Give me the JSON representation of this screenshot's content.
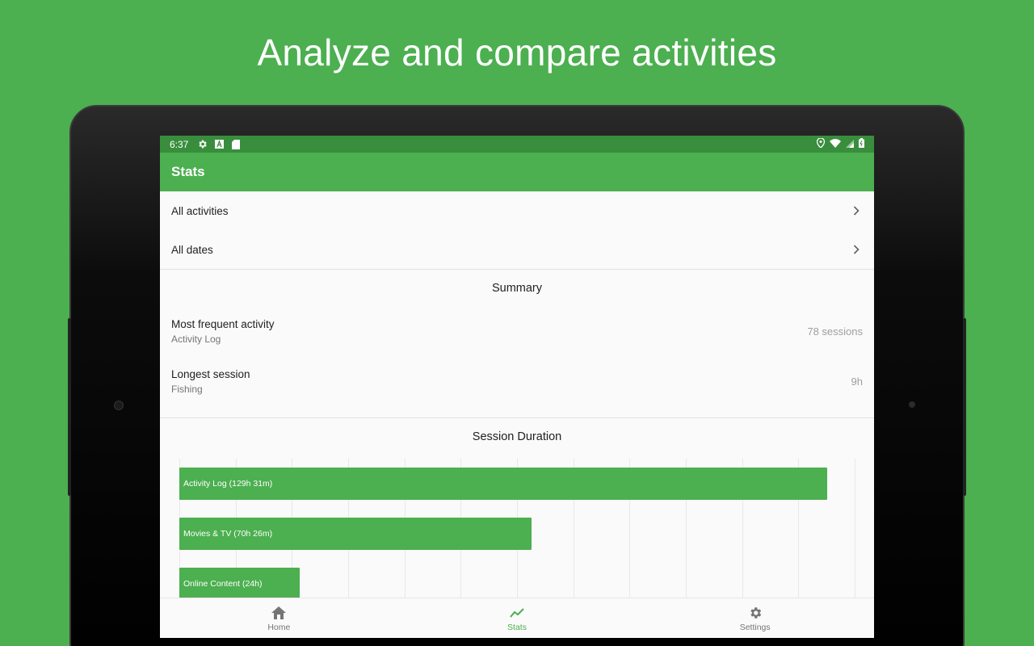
{
  "headline": "Analyze and compare activities",
  "statusbar": {
    "time": "6:37"
  },
  "appbar": {
    "title": "Stats"
  },
  "filters": [
    {
      "label": "All activities"
    },
    {
      "label": "All dates"
    }
  ],
  "summary": {
    "title": "Summary",
    "items": [
      {
        "primary": "Most frequent activity",
        "secondary": "Activity Log",
        "value": "78 sessions"
      },
      {
        "primary": "Longest session",
        "secondary": "Fishing",
        "value": "9h"
      }
    ]
  },
  "chart_data": {
    "type": "bar",
    "orientation": "horizontal",
    "title": "Session Duration",
    "categories": [
      "Activity Log (129h 31m)",
      "Movies & TV (70h 26m)",
      "Online Content (24h)"
    ],
    "values": [
      129.52,
      70.43,
      24
    ],
    "xlim": [
      0,
      135
    ],
    "grid": true
  },
  "bottom_nav": [
    {
      "label": "Home",
      "icon": "home-icon",
      "active": false
    },
    {
      "label": "Stats",
      "icon": "stats-icon",
      "active": true
    },
    {
      "label": "Settings",
      "icon": "settings-icon",
      "active": false
    }
  ],
  "colors": {
    "background": "#4caf50",
    "primary": "#4caf50",
    "primary_dark": "#388e3c"
  }
}
